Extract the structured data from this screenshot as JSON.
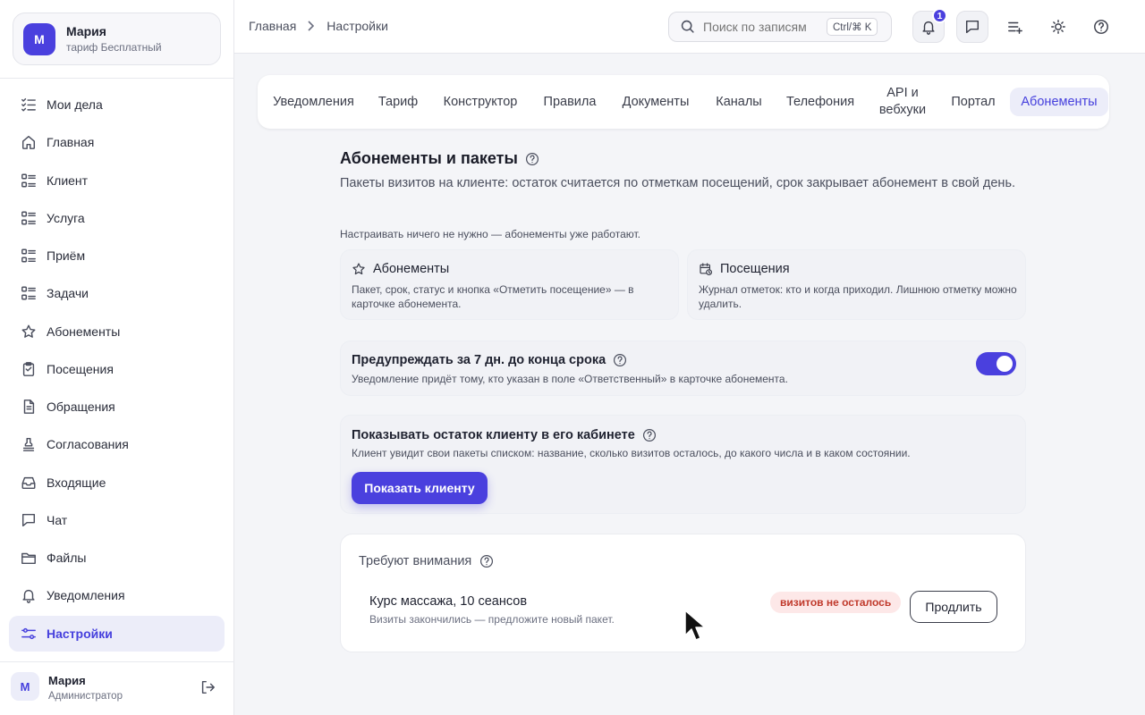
{
  "account": {
    "avatar": "М",
    "name": "Мария",
    "plan": "тариф Бесплатный"
  },
  "sidebar": {
    "items": [
      {
        "label": "Мои дела",
        "icon": "checklist-icon"
      },
      {
        "label": "Главная",
        "icon": "home-icon"
      },
      {
        "label": "Клиент",
        "icon": "list-icon"
      },
      {
        "label": "Услуга",
        "icon": "list-icon"
      },
      {
        "label": "Приём",
        "icon": "list-icon"
      },
      {
        "label": "Задачи",
        "icon": "list-icon"
      },
      {
        "label": "Абонементы",
        "icon": "star-icon"
      },
      {
        "label": "Посещения",
        "icon": "clipboard-icon"
      },
      {
        "label": "Обращения",
        "icon": "document-icon"
      },
      {
        "label": "Согласования",
        "icon": "stamp-icon"
      },
      {
        "label": "Входящие",
        "icon": "inbox-icon"
      },
      {
        "label": "Чат",
        "icon": "chat-icon"
      },
      {
        "label": "Файлы",
        "icon": "folder-icon"
      },
      {
        "label": "Уведомления",
        "icon": "bell-icon"
      },
      {
        "label": "Настройки",
        "icon": "sliders-icon",
        "active": true
      }
    ]
  },
  "user": {
    "avatar": "М",
    "name": "Мария",
    "role": "Администратор"
  },
  "header": {
    "breadcrumb": [
      "Главная",
      "Настройки"
    ],
    "search": {
      "placeholder": "Поиск по записям",
      "shortcut": "Ctrl/⌘ K"
    },
    "notifications_count": "1"
  },
  "tabs": [
    {
      "label": "Уведомления"
    },
    {
      "label": "Тариф"
    },
    {
      "label": "Конструктор"
    },
    {
      "label": "Правила"
    },
    {
      "label": "Документы"
    },
    {
      "label": "Каналы"
    },
    {
      "label": "Телефония"
    },
    {
      "label": "API и вебхуки"
    },
    {
      "label": "Портал"
    },
    {
      "label": "Абонементы",
      "active": true
    }
  ],
  "section": {
    "title": "Абонементы и пакеты",
    "description": "Пакеты визитов на клиенте: остаток считается по отметкам посещений, срок закрывает абонемент в свой день.",
    "note": "Настраивать ничего не нужно — абонементы уже работают."
  },
  "features": [
    {
      "title": "Абонементы",
      "icon": "star-icon",
      "description": "Пакет, срок, статус и кнопка «Отметить посещение» — в карточке абонемента."
    },
    {
      "title": "Посещения",
      "icon": "calendar-clock-icon",
      "description": "Журнал отметок: кто и когда приходил. Лишнюю отметку можно удалить."
    }
  ],
  "warn_setting": {
    "title": "Предупреждать за 7 дн. до конца срока",
    "description": "Уведомление придёт тому, кто указан в поле «Ответственный» в карточке абонемента.",
    "enabled": true,
    "accent": "#4a40de"
  },
  "client_setting": {
    "title": "Показывать остаток клиенту в его кабинете",
    "description": "Клиент увидит свои пакеты списком: название, сколько визитов осталось, до какого числа и в каком состоянии.",
    "button": "Показать клиенту"
  },
  "attention": {
    "title": "Требуют внимания",
    "item": {
      "name": "Курс массажа, 10 сеансов",
      "subtitle": "Визиты закончились — предложите новый пакет.",
      "status": "визитов не осталось",
      "status_color": "#c0392b",
      "action": "Продлить"
    }
  }
}
